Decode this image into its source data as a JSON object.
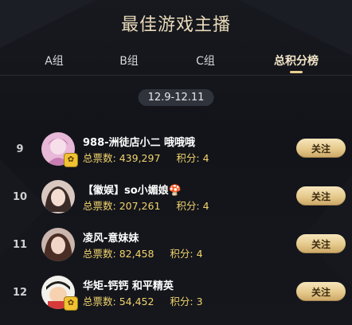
{
  "header": {
    "title": "最佳游戏主播"
  },
  "tabs": [
    {
      "label": "A组",
      "active": false
    },
    {
      "label": "B组",
      "active": false
    },
    {
      "label": "C组",
      "active": false
    },
    {
      "label": "总积分榜",
      "active": true
    }
  ],
  "date_range": "12.9-12.11",
  "labels": {
    "votes": "总票数:",
    "points": "积分:",
    "follow": "关注"
  },
  "entries": [
    {
      "rank": "9",
      "name": "988-洲徒店小二 哦哦哦",
      "votes": "439,297",
      "points": "4",
      "badge": true
    },
    {
      "rank": "10",
      "name": "【徽娱】so小媚娘🍄",
      "votes": "207,261",
      "points": "4",
      "badge": false
    },
    {
      "rank": "11",
      "name": "凌风-意妹妹",
      "votes": "82,458",
      "points": "4",
      "badge": false
    },
    {
      "rank": "12",
      "name": "华矩-钙钙 和平精英",
      "votes": "54,452",
      "points": "3",
      "badge": true
    }
  ],
  "colors": {
    "accent": "#e8cf8f",
    "stats": "#f2d36b",
    "background": "#14161b"
  }
}
